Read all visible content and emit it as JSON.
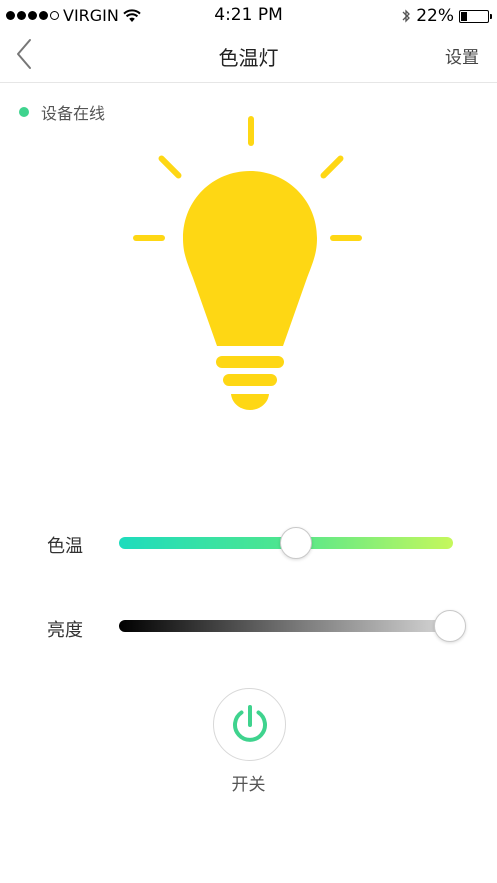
{
  "status_bar": {
    "carrier": "VIRGIN",
    "time": "4:21 PM",
    "battery_text": "22%",
    "battery_level": 0.22,
    "signal_bars_filled": 4,
    "signal_bars_total": 5,
    "icons": [
      "wifi-icon",
      "bluetooth-icon",
      "battery-icon"
    ]
  },
  "nav": {
    "title": "色温灯",
    "settings_label": "设置",
    "back_icon": "chevron-left-icon"
  },
  "device": {
    "status_text": "设备在线",
    "status_color": "#3fd38e",
    "bulb_color": "#fed714",
    "bulb_icon": "lightbulb-icon"
  },
  "controls": {
    "color_temp": {
      "label": "色温",
      "value": 0.53,
      "gradient": [
        "#1edcbd",
        "#4fe68e",
        "#c6f85c"
      ]
    },
    "brightness": {
      "label": "亮度",
      "value": 1.0,
      "gradient": [
        "#000000",
        "#d9d9d9"
      ]
    }
  },
  "power": {
    "label": "开关",
    "icon": "power-icon",
    "color": "#3fd38e"
  }
}
